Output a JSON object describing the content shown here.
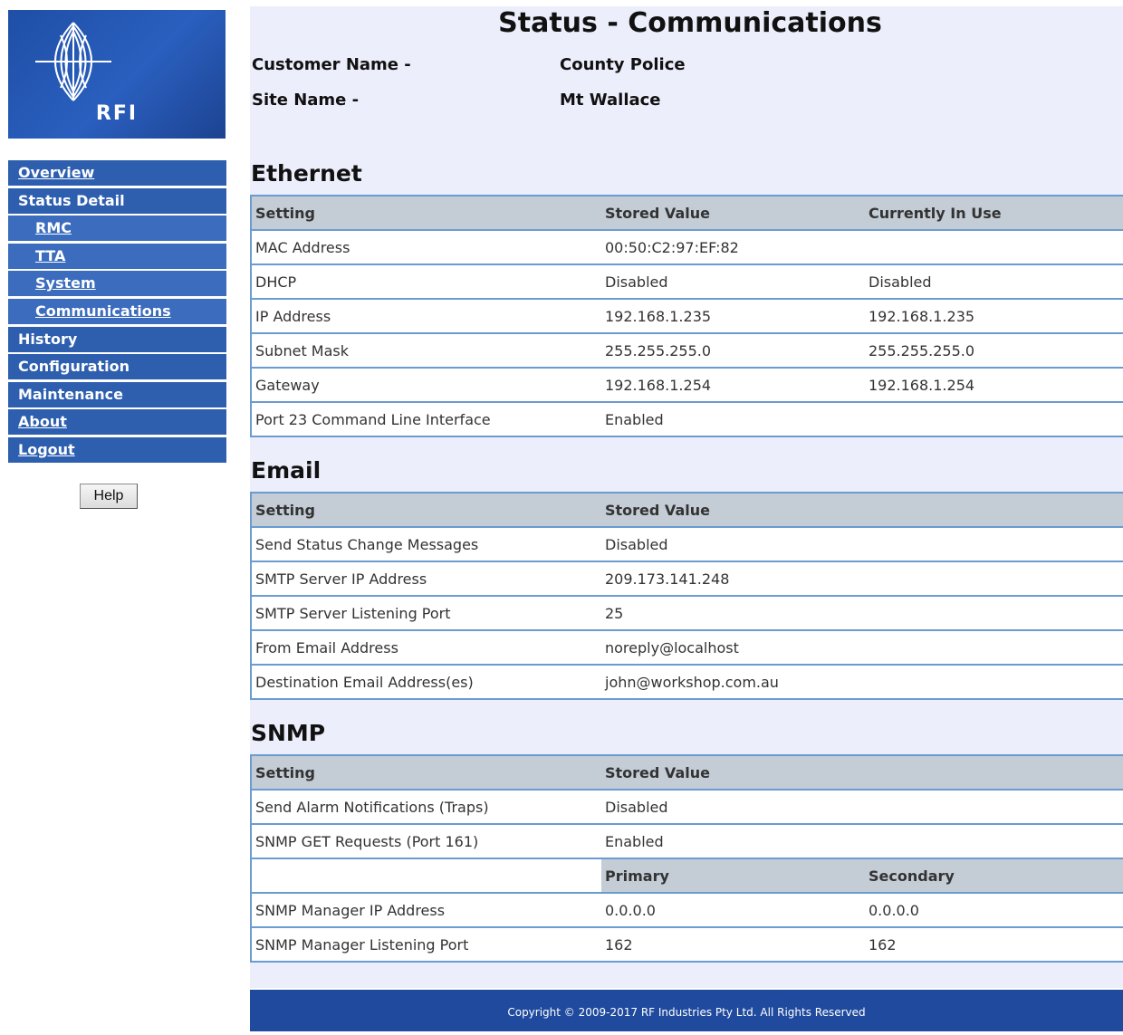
{
  "logo": {
    "text": "RFI"
  },
  "nav": {
    "items": [
      {
        "label": "Overview"
      },
      {
        "label": "Status Detail"
      },
      {
        "label": "RMC"
      },
      {
        "label": "TTA"
      },
      {
        "label": "System"
      },
      {
        "label": "Communications"
      },
      {
        "label": "History"
      },
      {
        "label": "Configuration"
      },
      {
        "label": "Maintenance"
      },
      {
        "label": "About"
      },
      {
        "label": "Logout"
      }
    ],
    "help_label": "Help"
  },
  "page": {
    "title": "Status - Communications",
    "customer_label": "Customer Name -",
    "customer_value": "County Police",
    "site_label": "Site Name -",
    "site_value": "Mt Wallace"
  },
  "ethernet": {
    "title": "Ethernet",
    "headers": [
      "Setting",
      "Stored Value",
      "Currently In Use"
    ],
    "rows": [
      [
        "MAC Address",
        "00:50:C2:97:EF:82",
        ""
      ],
      [
        "DHCP",
        "Disabled",
        "Disabled"
      ],
      [
        "IP Address",
        "192.168.1.235",
        "192.168.1.235"
      ],
      [
        "Subnet Mask",
        "255.255.255.0",
        "255.255.255.0"
      ],
      [
        "Gateway",
        "192.168.1.254",
        "192.168.1.254"
      ],
      [
        "Port 23 Command Line Interface",
        "Enabled",
        ""
      ]
    ]
  },
  "email": {
    "title": "Email",
    "headers": [
      "Setting",
      "Stored Value",
      ""
    ],
    "rows": [
      [
        "Send Status Change Messages",
        "Disabled",
        ""
      ],
      [
        "SMTP Server IP Address",
        "209.173.141.248",
        ""
      ],
      [
        "SMTP Server Listening Port",
        "25",
        ""
      ],
      [
        "From Email Address",
        "noreply@localhost",
        ""
      ],
      [
        "Destination Email Address(es)",
        "john@workshop.com.au",
        ""
      ]
    ]
  },
  "snmp": {
    "title": "SNMP",
    "headers": [
      "Setting",
      "Stored Value",
      ""
    ],
    "rows": [
      [
        "Send Alarm Notifications (Traps)",
        "Disabled",
        ""
      ],
      [
        "SNMP GET Requests (Port 161)",
        "Enabled",
        ""
      ]
    ],
    "sub_headers": [
      "",
      "Primary",
      "Secondary"
    ],
    "sub_rows": [
      [
        "SNMP Manager IP Address",
        "0.0.0.0",
        "0.0.0.0"
      ],
      [
        "SNMP Manager Listening Port",
        "162",
        "162"
      ]
    ]
  },
  "footer": {
    "text": "Copyright © 2009-2017 RF Industries Pty Ltd. All Rights Reserved"
  },
  "colors": {
    "nav_bg": "#2e5faf",
    "main_bg": "#eceefb",
    "header_bg": "#c4ccd6",
    "border": "#6a9bd1",
    "footer_bg": "#1f4a9d"
  }
}
